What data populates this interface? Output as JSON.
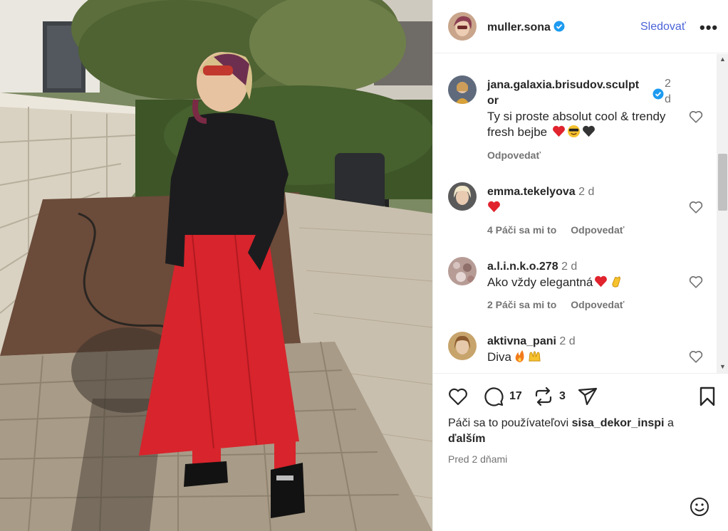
{
  "post": {
    "username": "muller.sona",
    "follow_label": "Sledovať",
    "more_label": "•••"
  },
  "comments": [
    {
      "user": "jana.galaxia.brisudov.sculpt",
      "user_cont": "or",
      "time": "2",
      "time_cont": "d",
      "text_line1": "Ty si proste absolut cool & trendy",
      "text_line2": "fresh bejbe",
      "emojis": [
        "red-heart",
        "sunglasses-face",
        "black-heart"
      ],
      "reply_label": "Odpovedať"
    },
    {
      "user": "emma.tekelyova",
      "time": "2 d",
      "emojis": [
        "red-heart"
      ],
      "likes_label": "4 Páči sa mi to",
      "reply_label": "Odpovedať"
    },
    {
      "user": "a.l.i.n.k.o.278",
      "time": "2 d",
      "text": "Ako vždy elegantná",
      "emojis": [
        "red-heart",
        "clapping-hands"
      ],
      "likes_label": "2 Páči sa mi to",
      "reply_label": "Odpovedať"
    },
    {
      "user": "aktivna_pani",
      "time": "2 d",
      "text": "Diva",
      "emojis": [
        "fire",
        "raising-hands"
      ]
    }
  ],
  "actions": {
    "comment_count": "17",
    "repost_count": "3"
  },
  "likes": {
    "prefix": "Páči sa to používateľovi",
    "user": "sisa_dekor_inspi",
    "suffix": "a",
    "others": "ďalším"
  },
  "posted": "Pred 2 dňami",
  "colors": {
    "accent": "#4a63d8",
    "verified": "#1d9bf0",
    "text": "#262626",
    "muted": "#737373",
    "heart_red": "#e0232d"
  }
}
